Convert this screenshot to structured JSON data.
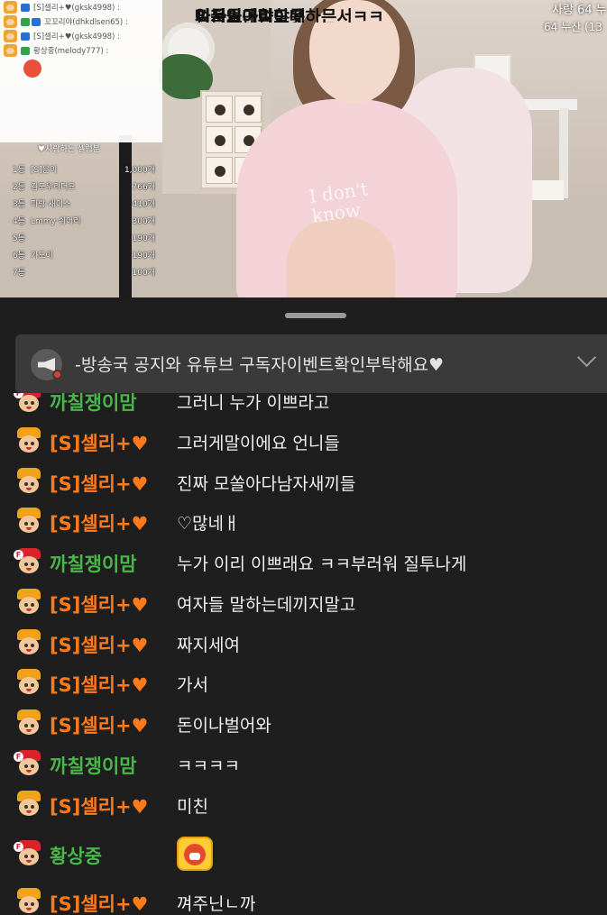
{
  "overlay": {
    "chat_lines": [
      {
        "kind": "text",
        "text": "짜져있어여"
      },
      {
        "kind": "user",
        "badges": [
          "b"
        ],
        "nick": "[S]셀리+♥(gksk4998) :"
      },
      {
        "kind": "text",
        "text": "여자들대화할때"
      },
      {
        "kind": "user",
        "badges": [
          "b"
        ],
        "nick": "꼬꼬리야(dhkdlsen65) :"
      },
      {
        "kind": "text",
        "text": "얼굴보곤말도못하믄서ㅋㅋ"
      },
      {
        "kind": "user",
        "badges": [
          "b"
        ],
        "nick": "[S]셀리+♥(gksk4998) :"
      },
      {
        "kind": "text",
        "text": "끼는거아니야"
      },
      {
        "kind": "user",
        "badges": [
          "g"
        ],
        "nick": "황상중(melody777) :"
      }
    ],
    "ranking_title": "♥사랑하는 셀럽분",
    "ranking": [
      {
        "rank": "1등",
        "name": "[S]은이",
        "count": "1,000개"
      },
      {
        "rank": "2등",
        "name": "김도우리더요",
        "count": "766개"
      },
      {
        "rank": "3등",
        "name": "파랑·새이스",
        "count": "410개"
      },
      {
        "rank": "4등",
        "name": "Lmmy·쉬어리",
        "count": "300개"
      },
      {
        "rank": "5등",
        "name": "",
        "count": "190개"
      },
      {
        "rank": "6등",
        "name": "가도이",
        "count": "190개"
      },
      {
        "rank": "7등",
        "name": "",
        "count": "100개"
      }
    ],
    "top_right_1": "사랑 64 누",
    "top_right_2": "64 누산 (13"
  },
  "notice": {
    "text": "-방송국 공지와 유튜브 구독자이벤트확인부탁해요♥"
  },
  "chat": [
    {
      "nick": "까칠쟁이맘",
      "type": "fan",
      "text": "그러니 누가 이쁘라고"
    },
    {
      "nick": "[S]셀리+♥",
      "type": "s",
      "text": "그러게말이에요 언니들"
    },
    {
      "nick": "[S]셀리+♥",
      "type": "s",
      "text": "진짜 모쏠아다남자새끼들"
    },
    {
      "nick": "[S]셀리+♥",
      "type": "s",
      "text": "♡많네ㅐ"
    },
    {
      "nick": "까칠쟁이맘",
      "type": "fan",
      "text": "누가 이리 이쁘래요 ㅋㅋ부러워 질투나게"
    },
    {
      "nick": "[S]셀리+♥",
      "type": "s",
      "text": "여자들 말하는데끼지말고"
    },
    {
      "nick": "[S]셀리+♥",
      "type": "s",
      "text": "짜지세여"
    },
    {
      "nick": "[S]셀리+♥",
      "type": "s",
      "text": "가서"
    },
    {
      "nick": "[S]셀리+♥",
      "type": "s",
      "text": "돈이나벌어와"
    },
    {
      "nick": "까칠쟁이맘",
      "type": "fan",
      "text": "ㅋㅋㅋㅋ"
    },
    {
      "nick": "[S]셀리+♥",
      "type": "s",
      "text": "미친"
    },
    {
      "nick": "황상중",
      "type": "fan",
      "text": ""
    },
    {
      "nick": "[S]셀리+♥",
      "type": "s",
      "text": "껴주닌ㄴ까"
    }
  ],
  "colors": {
    "fan_nick": "#49b64a",
    "s_nick": "#ff7a1a",
    "background": "#1e1e1e"
  }
}
